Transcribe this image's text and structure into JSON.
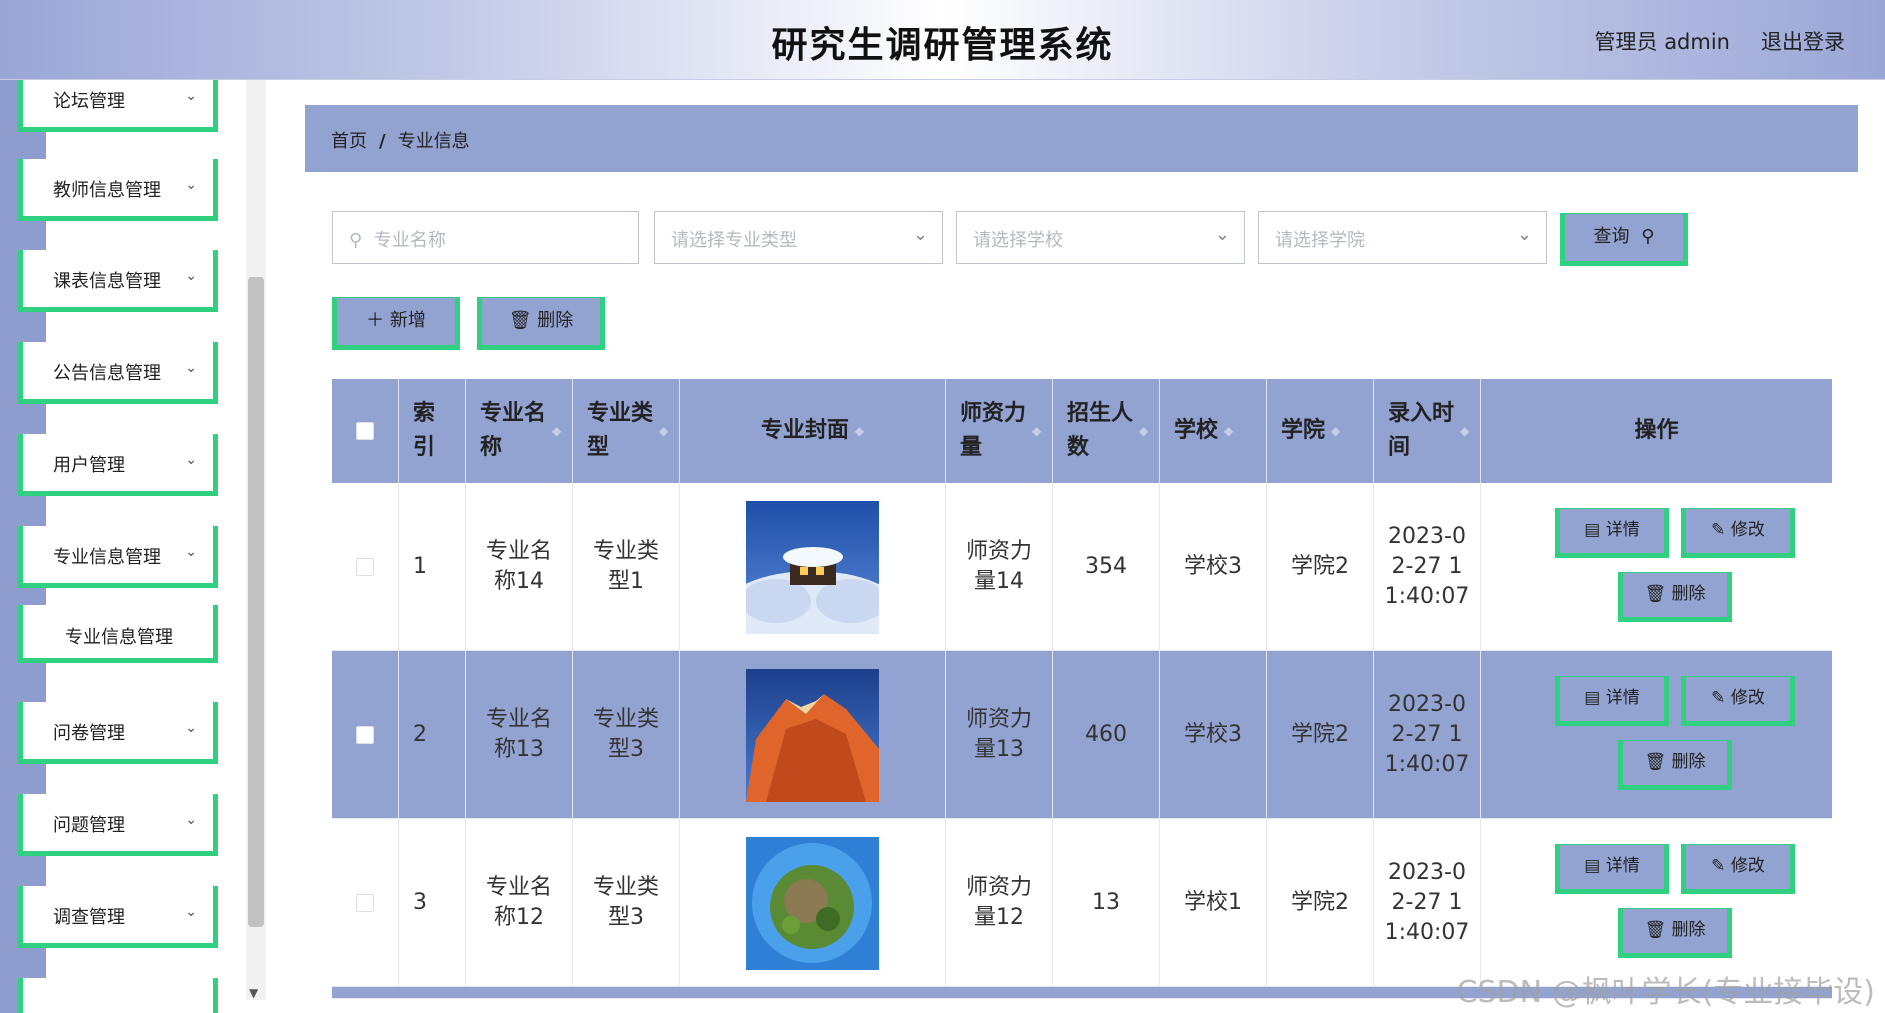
{
  "header": {
    "title": "研究生调研管理系统",
    "user": "管理员 admin",
    "logout": "退出登录"
  },
  "sidebar": {
    "items": [
      {
        "label": "论坛管理"
      },
      {
        "label": "教师信息管理"
      },
      {
        "label": "课表信息管理"
      },
      {
        "label": "公告信息管理"
      },
      {
        "label": "用户管理"
      },
      {
        "label": "专业信息管理"
      },
      {
        "label": "问卷管理"
      },
      {
        "label": "问题管理"
      },
      {
        "label": "调查管理"
      }
    ],
    "submenu": {
      "label": "专业信息管理"
    },
    "chevron": "⌄"
  },
  "breadcrumb": {
    "home": "首页",
    "separator": "/",
    "current": "专业信息"
  },
  "search": {
    "name_placeholder": "专业名称",
    "type_placeholder": "请选择专业类型",
    "school_placeholder": "请选择学校",
    "college_placeholder": "请选择学院",
    "query_label": "查询"
  },
  "actions": {
    "add_label": "新增",
    "delete_label": "删除"
  },
  "table": {
    "headers": {
      "index": "索\n引",
      "name": "专业名\n称",
      "type": "专业类\n型",
      "cover": "专业封面",
      "faculty": "师资力\n量",
      "enroll": "招生人\n数",
      "school": "学校",
      "college": "学院",
      "time": "录入时\n间",
      "ops": "操作"
    },
    "rows": [
      {
        "index": "1",
        "name": "专业名\n称14",
        "type": "专业类\n型1",
        "cover": "snow-house",
        "faculty": "师资力\n量14",
        "enroll": "354",
        "school": "学校3",
        "college": "学院2",
        "time": "2023-0\n2-27 1\n1:40:07"
      },
      {
        "index": "2",
        "name": "专业名\n称13",
        "type": "专业类\n型3",
        "cover": "red-mountain",
        "faculty": "师资力\n量13",
        "enroll": "460",
        "school": "学校3",
        "college": "学院2",
        "time": "2023-0\n2-27 1\n1:40:07"
      },
      {
        "index": "3",
        "name": "专业名\n称12",
        "type": "专业类\n型3",
        "cover": "tiny-planet",
        "faculty": "师资力\n量12",
        "enroll": "13",
        "school": "学校1",
        "college": "学院2",
        "time": "2023-0\n2-27 1\n1:40:07"
      }
    ],
    "op_labels": {
      "detail": "详情",
      "edit": "修改",
      "delete": "删除"
    }
  },
  "watermark": "CSDN @枫叶学长(专业接毕设)",
  "colors": {
    "accent_green": "#2fd07f",
    "panel_blue": "#93a3d1"
  }
}
